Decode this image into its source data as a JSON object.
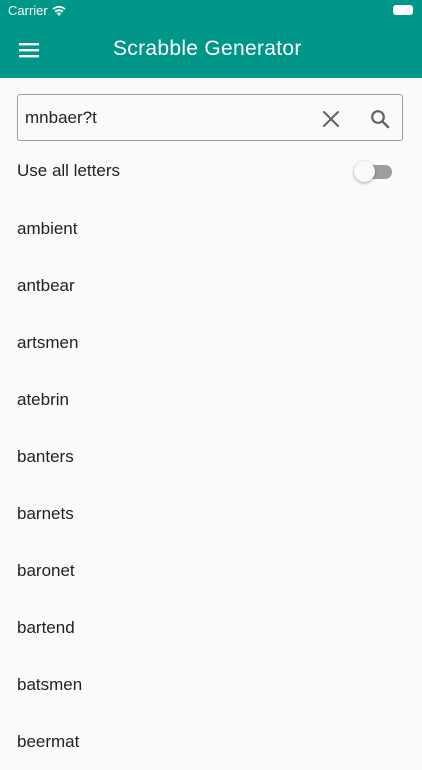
{
  "status_bar": {
    "carrier": "Carrier"
  },
  "app_bar": {
    "title": "Scrabble Generator",
    "menu_icon": "hamburger-menu-icon",
    "background_color": "#009688"
  },
  "search": {
    "value": "mnbaer?t",
    "clear_icon": "close-icon",
    "search_icon": "search-icon"
  },
  "options": {
    "use_all_letters_label": "Use all letters",
    "use_all_letters_enabled": false
  },
  "results": [
    "ambient",
    "antbear",
    "artsmen",
    "atebrin",
    "banters",
    "barnets",
    "baronet",
    "bartend",
    "batsmen",
    "beermat"
  ]
}
